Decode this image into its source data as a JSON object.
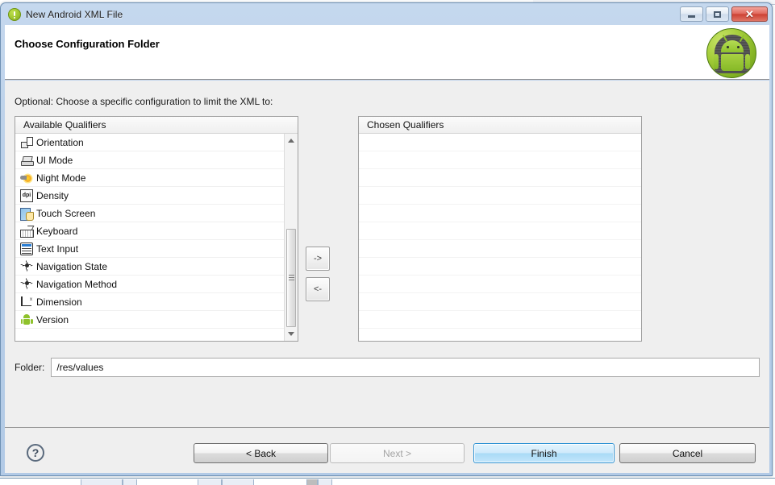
{
  "window": {
    "title": "New Android XML File",
    "icon": "android-info-icon",
    "controls": {
      "minimize": "minimize-icon",
      "maximize": "maximize-icon",
      "close": "✕"
    }
  },
  "header": {
    "title": "Choose Configuration Folder",
    "graphic": "android-robot-badge"
  },
  "body": {
    "hint": "Optional: Choose a specific configuration to limit the XML to:",
    "available_list": {
      "header": "Available Qualifiers",
      "items": [
        {
          "label": "Orientation",
          "icon": "orientation-icon"
        },
        {
          "label": "UI Mode",
          "icon": "ui-mode-icon"
        },
        {
          "label": "Night Mode",
          "icon": "night-mode-icon"
        },
        {
          "label": "Density",
          "icon": "density-icon",
          "icon_text": "dpi"
        },
        {
          "label": "Touch Screen",
          "icon": "touch-screen-icon"
        },
        {
          "label": "Keyboard",
          "icon": "keyboard-icon"
        },
        {
          "label": "Text Input",
          "icon": "text-input-icon"
        },
        {
          "label": "Navigation State",
          "icon": "navigation-state-icon"
        },
        {
          "label": "Navigation Method",
          "icon": "navigation-method-icon"
        },
        {
          "label": "Dimension",
          "icon": "dimension-icon"
        },
        {
          "label": "Version",
          "icon": "version-icon"
        }
      ]
    },
    "chosen_list": {
      "header": "Chosen Qualifiers",
      "items": []
    },
    "transfer": {
      "add_label": "->",
      "remove_label": "<-"
    },
    "folder": {
      "label": "Folder:",
      "value": "/res/values",
      "placeholder": ""
    }
  },
  "footer": {
    "help": "?",
    "back": "< Back",
    "next": "Next >",
    "finish": "Finish",
    "cancel": "Cancel"
  },
  "colors": {
    "titlebar": "#b9cfe8",
    "body": "#efefef",
    "accent_default_button": "#2f93d4",
    "android_green": "#8fc22c"
  }
}
